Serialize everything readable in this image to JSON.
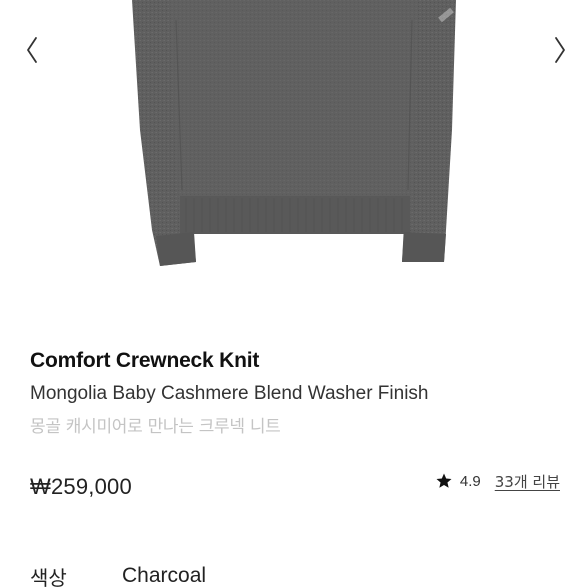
{
  "gallery": {
    "prev_icon": "chevron-left-icon",
    "next_icon": "chevron-right-icon",
    "image_color": "#5f5f5f"
  },
  "product": {
    "title": "Comfort Crewneck Knit",
    "subtitle": "Mongolia Baby Cashmere Blend Washer Finish",
    "subtitle_ko": "몽골 캐시미어로 만나는 크루넥 니트",
    "price": "₩259,000"
  },
  "rating": {
    "icon": "star-icon",
    "score": "4.9",
    "reviews": "33개 리뷰"
  },
  "option": {
    "label": "색상",
    "value": "Charcoal"
  }
}
